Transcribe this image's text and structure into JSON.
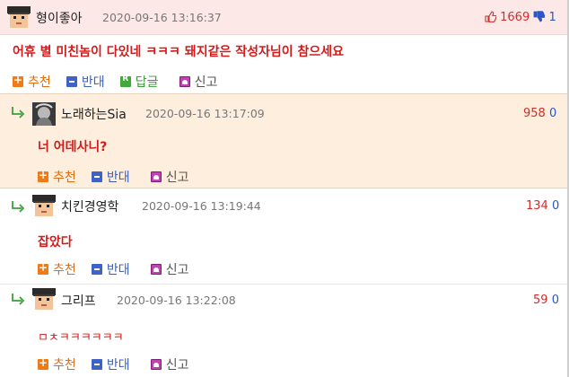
{
  "actions": {
    "recommend": "추천",
    "oppose": "반대",
    "reply": "답글",
    "report": "신고"
  },
  "comments": [
    {
      "nickname": "형이좋아",
      "timestamp": "2020-09-16 13:16:37",
      "text": "어휴 별 미친놈이 다있네 ㅋㅋㅋ 돼지같은 작성자님이 참으세요",
      "upvotes": "1669",
      "downvotes": "1",
      "is_reply": false
    },
    {
      "nickname": "노래하는Sia",
      "timestamp": "2020-09-16 13:17:09",
      "text": "너 어데사니?",
      "upvotes": "958",
      "downvotes": "0",
      "is_reply": true
    },
    {
      "nickname": "치킨경영학",
      "timestamp": "2020-09-16 13:19:44",
      "text": "잡았다",
      "upvotes": "134",
      "downvotes": "0",
      "is_reply": true
    },
    {
      "nickname": "그리프",
      "timestamp": "2020-09-16 13:22:08",
      "text": "ㅁㅊㅋㅋㅋㅋㅋㅋ",
      "upvotes": "59",
      "downvotes": "0",
      "is_reply": true
    }
  ],
  "colors": {
    "highlight_header": "#fde8e8",
    "highlight_row": "#fdeedd",
    "comment_text": "#d31b1b",
    "upvote": "#d42b2b",
    "downvote": "#2b56c8"
  }
}
